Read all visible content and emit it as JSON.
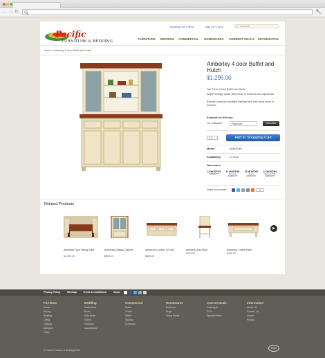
{
  "header": {
    "cart_link": "Shopping Cart 0 items",
    "signup_link": "Sign Up / Log In",
    "search_placeholder": "Keywords",
    "logo_word": "Pacific",
    "logo_tagline": "FURNITURE & BEDDING"
  },
  "nav": [
    {
      "label": "FURNITURE"
    },
    {
      "label": "BEDDING"
    },
    {
      "label": "COMMERCIAL"
    },
    {
      "label": "HOMEWARES"
    },
    {
      "label": "CURRENT DEALS"
    },
    {
      "label": "INFORMATION"
    }
  ],
  "breadcrumb": "Home > Amberley 4 door Buffet and Hutch",
  "product": {
    "title": "Amberley 4 door Buffet and Hutch",
    "price": "$1,295.00",
    "description": [
      "Two Tone 4 Door Buffet and Hutch.",
      "Ample storage space with plenty of drawers and cupboards.",
      "Beautiful diamond leadlight highlight this well made piece of furniture."
    ],
    "delivery_heading": "Estimate for delivery:",
    "postcode_label": "For postcode:",
    "postcode_value": "Postcode",
    "calculate_label": "Calculate",
    "qty_value": "1",
    "add_to_cart": "Add to Shopping Cart",
    "model_label": "Model:",
    "model_value": "AMB4DBH",
    "availability_label": "Availability:",
    "availability_value": "In Stock",
    "warranties_label": "Warranties:",
    "warranties": [
      {
        "months": "12 MONTHS",
        "type": "",
        "word": "WARRANTY"
      },
      {
        "months": "12 MONTHS",
        "type": "Materials",
        "word": "WARRANTY"
      },
      {
        "months": "12 MONTHS",
        "type": "Frame",
        "word": "WARRANTY"
      },
      {
        "months": "12 MONTHS",
        "type": "Workmanship",
        "word": "WARRANTY"
      }
    ],
    "share_label": "Share this product:",
    "share_count": "0"
  },
  "related": {
    "heading": "Related Products",
    "items": [
      {
        "name": "Amberley 7pce Dining Suite",
        "price": "$1,099.00"
      },
      {
        "name": "Amberley Display Cabinet",
        "price": "$895.00"
      },
      {
        "name": "Amberley Lowline TV Unit",
        "price": "$565.00"
      },
      {
        "name": "Amberley Bar Stool",
        "price": "$149.00"
      },
      {
        "name": "Amberley Coffee Table",
        "price": "$445.00"
      }
    ]
  },
  "footer": {
    "bar": {
      "privacy": "Privacy Policy",
      "sitemap": "Sitemap",
      "terms": "Terms & Conditions",
      "share": "Share"
    },
    "columns": [
      {
        "heading": "Furniture",
        "items": [
          "Sofas",
          "Dining",
          "Seating",
          "Living",
          "Outdoor",
          "Antiques",
          "Office"
        ]
      },
      {
        "heading": "Bedding",
        "items": [
          "Mattresses",
          "Beds",
          "Kids Beds",
          "Suites",
          "Furniture",
          "Manchester"
        ]
      },
      {
        "heading": "Commercial",
        "items": [
          "Sofas",
          "Chairs",
          "Office",
          "Studios",
          "Contracts"
        ]
      },
      {
        "heading": "Homewares",
        "items": [
          "Bedroom",
          "Rugs",
          "Living Room"
        ]
      },
      {
        "heading": "Current Deals",
        "items": [
          "Catalogue",
          "T/C's",
          "Special Offers"
        ]
      },
      {
        "heading": "Information",
        "items": [
          "About Us",
          "Contact Us",
          "Stores",
          "Privacy"
        ]
      }
    ],
    "copyright": "© Pacific Furniture & Bedding 2011",
    "badge": "Hello"
  },
  "colors": {
    "link": "#2f5fa6",
    "nav": "#6b5a1e",
    "cart_button": "#2b68ba",
    "footer": "#5f5f57"
  }
}
